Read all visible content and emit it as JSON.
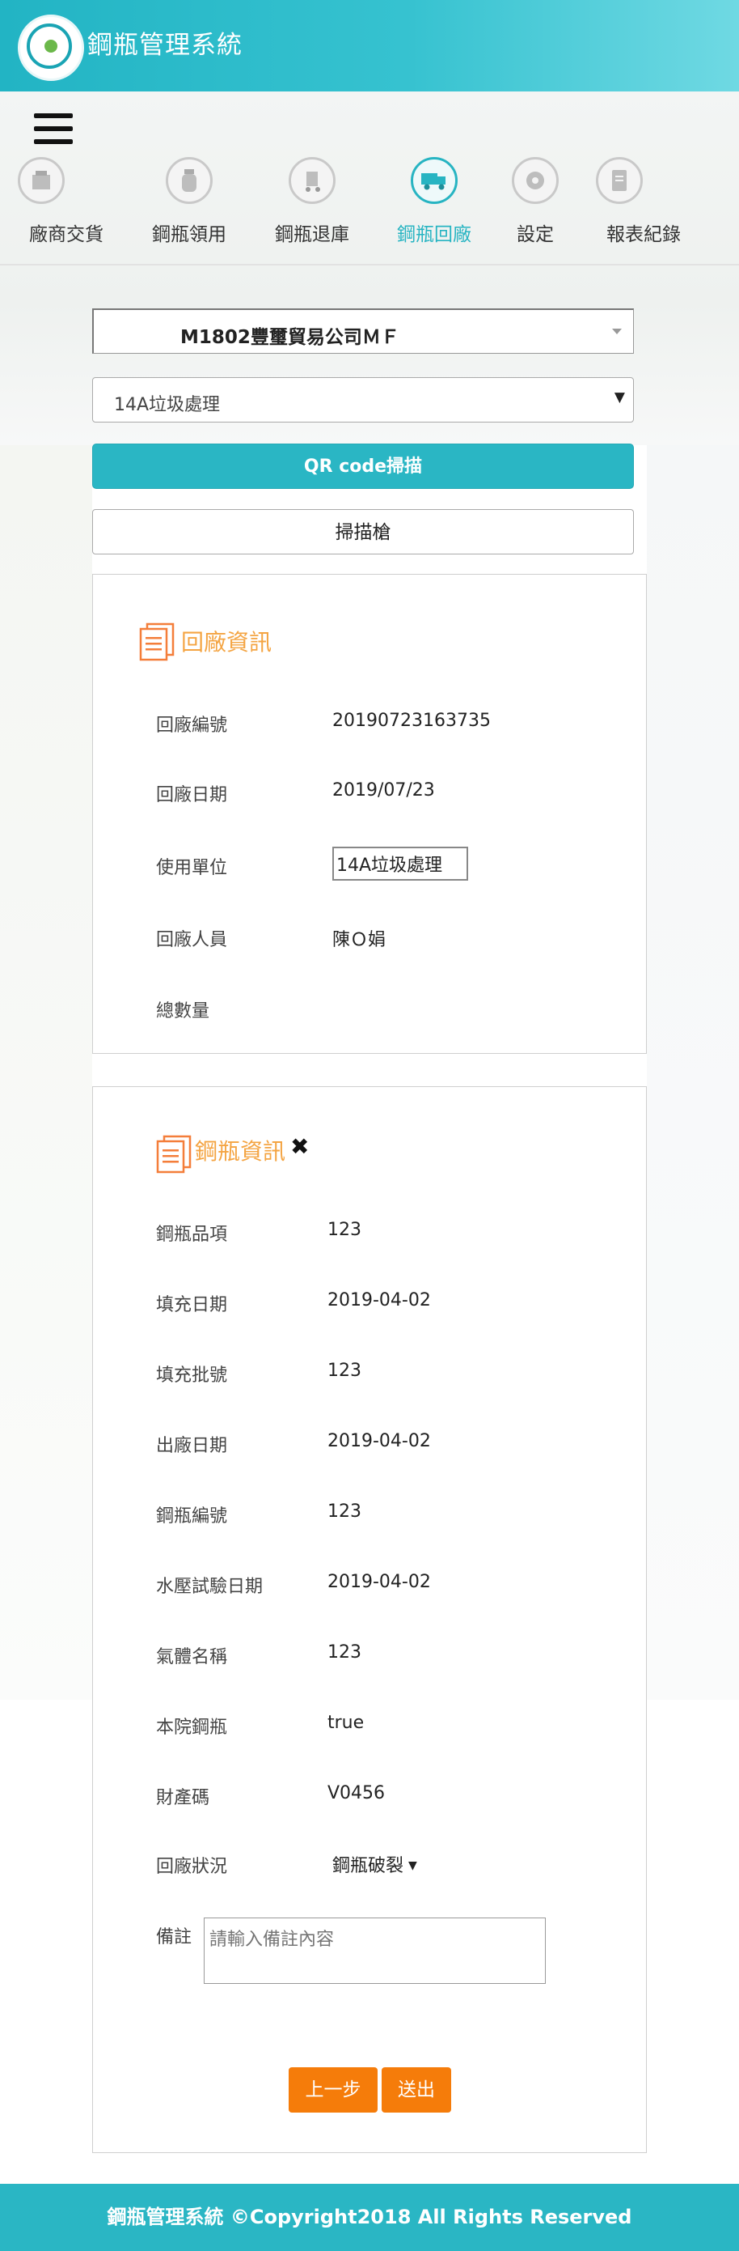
{
  "header": {
    "title": "鋼瓶管理系統"
  },
  "nav": [
    {
      "label": "廠商交貨",
      "icon": "delivery-box-icon",
      "active": false
    },
    {
      "label": "鋼瓶領用",
      "icon": "cylinder-icon",
      "active": false
    },
    {
      "label": "鋼瓶退庫",
      "icon": "return-cart-icon",
      "active": false
    },
    {
      "label": "鋼瓶回廠",
      "icon": "truck-icon",
      "active": true
    },
    {
      "label": "設定",
      "icon": "gear-icon",
      "active": false
    },
    {
      "label": "報表紀錄",
      "icon": "report-doc-icon",
      "active": false
    }
  ],
  "controls": {
    "vendor": "M1802豐璽貿易公司ＭＦ",
    "unit": "14A垃圾處理",
    "qr_button": "QR code掃描",
    "scanner_button": "掃描槍"
  },
  "return_info": {
    "title": "回廠資訊",
    "rows": [
      {
        "label": "回廠編號",
        "value": "20190723163735"
      },
      {
        "label": "回廠日期",
        "value": "2019/07/23"
      },
      {
        "label": "使用單位",
        "value": "14A垃圾處理"
      },
      {
        "label": "回廠人員",
        "value": "陳Ｏ娟"
      },
      {
        "label": "總數量",
        "value": ""
      }
    ]
  },
  "cylinder_info": {
    "title": "鋼瓶資訊",
    "rows": [
      {
        "label": "鋼瓶品項",
        "value": "123"
      },
      {
        "label": "填充日期",
        "value": "2019-04-02"
      },
      {
        "label": "填充批號",
        "value": "123"
      },
      {
        "label": "出廠日期",
        "value": "2019-04-02"
      },
      {
        "label": "鋼瓶編號",
        "value": "123"
      },
      {
        "label": "水壓試驗日期",
        "value": "2019-04-02"
      },
      {
        "label": "氣體名稱",
        "value": "123"
      },
      {
        "label": "本院鋼瓶",
        "value": "true"
      },
      {
        "label": "財產碼",
        "value": "V0456"
      }
    ],
    "status_label": "回廠狀況",
    "status_value": "鋼瓶破裂",
    "remark_label": "備註",
    "remark_placeholder": "請輸入備註內容",
    "prev_button": "上一步",
    "send_button": "送出"
  },
  "footer": {
    "text": "鋼瓶管理系統 ©Copyright2018 All Rights Reserved"
  },
  "colors": {
    "primary": "#2ab6c4",
    "accent": "#f4a442",
    "button_orange": "#f57c0a"
  }
}
